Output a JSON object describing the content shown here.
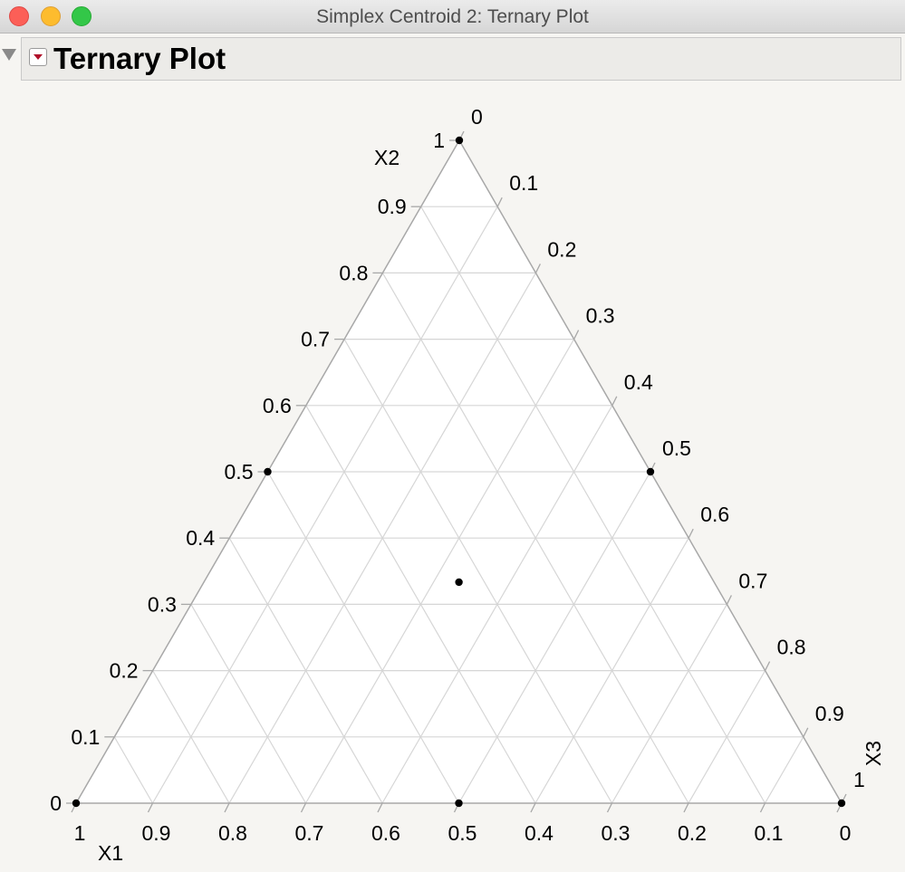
{
  "window": {
    "title": "Simplex Centroid 2: Ternary Plot"
  },
  "report": {
    "title": "Ternary Plot"
  },
  "chart_data": {
    "type": "ternary-scatter",
    "axes": [
      {
        "label": "X1",
        "ticks": [
          "0",
          "0.1",
          "0.2",
          "0.3",
          "0.4",
          "0.5",
          "0.6",
          "0.7",
          "0.8",
          "0.9",
          "1"
        ]
      },
      {
        "label": "X2",
        "ticks": [
          "0",
          "0.1",
          "0.2",
          "0.3",
          "0.4",
          "0.5",
          "0.6",
          "0.7",
          "0.8",
          "0.9",
          "1"
        ]
      },
      {
        "label": "X3",
        "ticks": [
          "0",
          "0.1",
          "0.2",
          "0.3",
          "0.4",
          "0.5",
          "0.6",
          "0.7",
          "0.8",
          "0.9",
          "1"
        ]
      }
    ],
    "grid": true,
    "points": [
      {
        "X1": 1,
        "X2": 0,
        "X3": 0
      },
      {
        "X1": 0,
        "X2": 1,
        "X3": 0
      },
      {
        "X1": 0,
        "X2": 0,
        "X3": 1
      },
      {
        "X1": 0.5,
        "X2": 0.5,
        "X3": 0
      },
      {
        "X1": 0.5,
        "X2": 0,
        "X3": 0.5
      },
      {
        "X1": 0,
        "X2": 0.5,
        "X3": 0.5
      },
      {
        "X1": 0.3333,
        "X2": 0.3333,
        "X3": 0.3333
      }
    ],
    "colors": {
      "grid": "#d6d6d6",
      "frame": "#a8a8a8",
      "point": "#000000",
      "plot_background": "#ffffff"
    }
  }
}
